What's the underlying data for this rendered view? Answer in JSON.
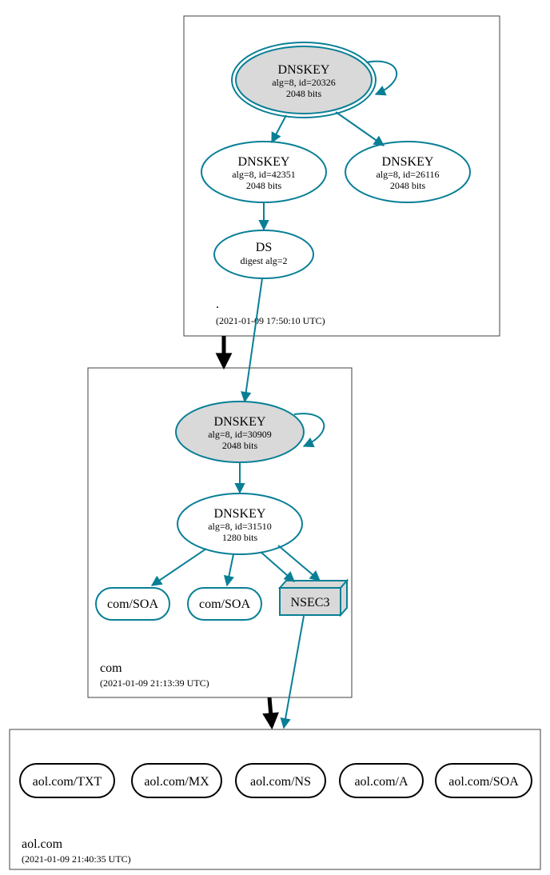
{
  "zones": {
    "root": {
      "label": ".",
      "timestamp": "(2021-01-09 17:50:10 UTC)"
    },
    "com": {
      "label": "com",
      "timestamp": "(2021-01-09 21:13:39 UTC)"
    },
    "aol": {
      "label": "aol.com",
      "timestamp": "(2021-01-09 21:40:35 UTC)"
    }
  },
  "nodes": {
    "rootKSK": {
      "title": "DNSKEY",
      "line1": "alg=8, id=20326",
      "line2": "2048 bits"
    },
    "rootZSK1": {
      "title": "DNSKEY",
      "line1": "alg=8, id=42351",
      "line2": "2048 bits"
    },
    "rootZSK2": {
      "title": "DNSKEY",
      "line1": "alg=8, id=26116",
      "line2": "2048 bits"
    },
    "rootDS": {
      "title": "DS",
      "line1": "digest alg=2"
    },
    "comKSK": {
      "title": "DNSKEY",
      "line1": "alg=8, id=30909",
      "line2": "2048 bits"
    },
    "comZSK": {
      "title": "DNSKEY",
      "line1": "alg=8, id=31510",
      "line2": "1280 bits"
    },
    "comSOA1": {
      "title": "com/SOA"
    },
    "comSOA2": {
      "title": "com/SOA"
    },
    "nsec3": {
      "title": "NSEC3"
    },
    "aolTXT": {
      "title": "aol.com/TXT"
    },
    "aolMX": {
      "title": "aol.com/MX"
    },
    "aolNS": {
      "title": "aol.com/NS"
    },
    "aolA": {
      "title": "aol.com/A"
    },
    "aolSOA": {
      "title": "aol.com/SOA"
    }
  }
}
